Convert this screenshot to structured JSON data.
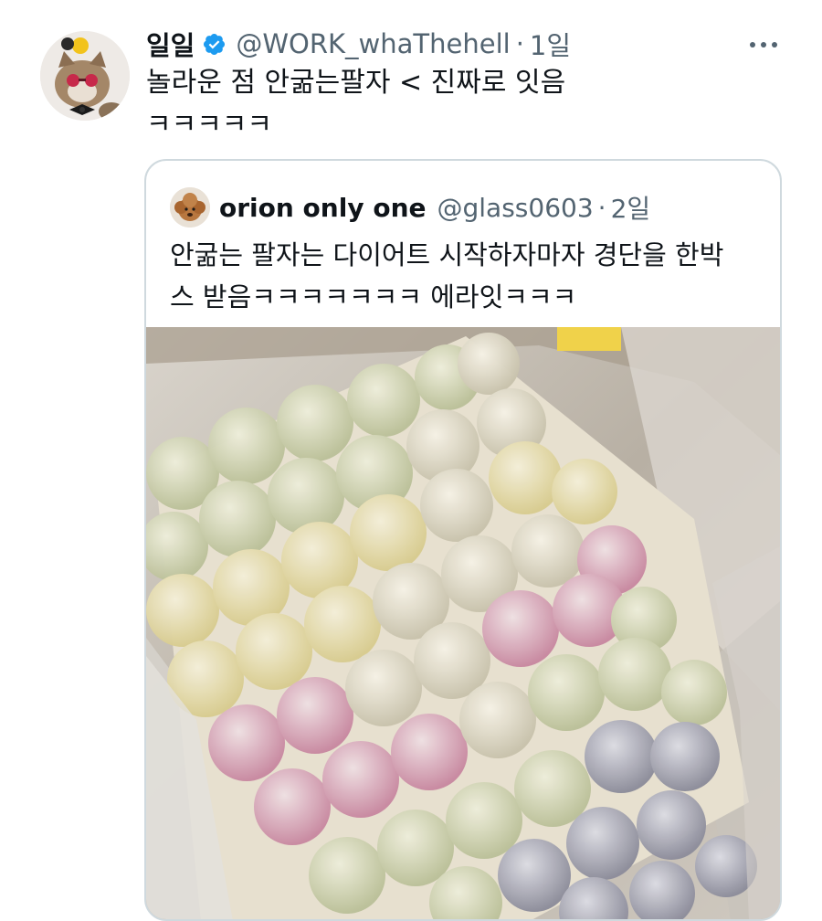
{
  "tweet": {
    "display_name": "일일",
    "verified_icon": "verified-badge-icon",
    "handle": "@WORK_whaThehell",
    "separator": "·",
    "time": "1일",
    "more_icon": "more-options-icon",
    "text_lines": [
      "놀라운 점 안굶는팔자 < 진짜로 잇음",
      "ㅋㅋㅋㅋㅋ"
    ],
    "avatar_icon": "cat-with-bowtie-avatar"
  },
  "quoted_tweet": {
    "display_name": "orion only one",
    "handle": "@glass0603",
    "separator": "·",
    "time": "2일",
    "avatar_icon": "poodle-dog-avatar",
    "text_lines": [
      "안굶는 팔자는 다이어트 시작하자마자 경단을 한박",
      "스 받음ㅋㅋㅋㅋㅋㅋㅋ 에라잇ㅋㅋㅋ"
    ],
    "media": "photo-box-of-coated-rice-cakes"
  },
  "colors": {
    "primary_text": "#0f1419",
    "secondary_text": "#536471",
    "verified_blue": "#1d9bf0",
    "border": "#cfd9de"
  }
}
